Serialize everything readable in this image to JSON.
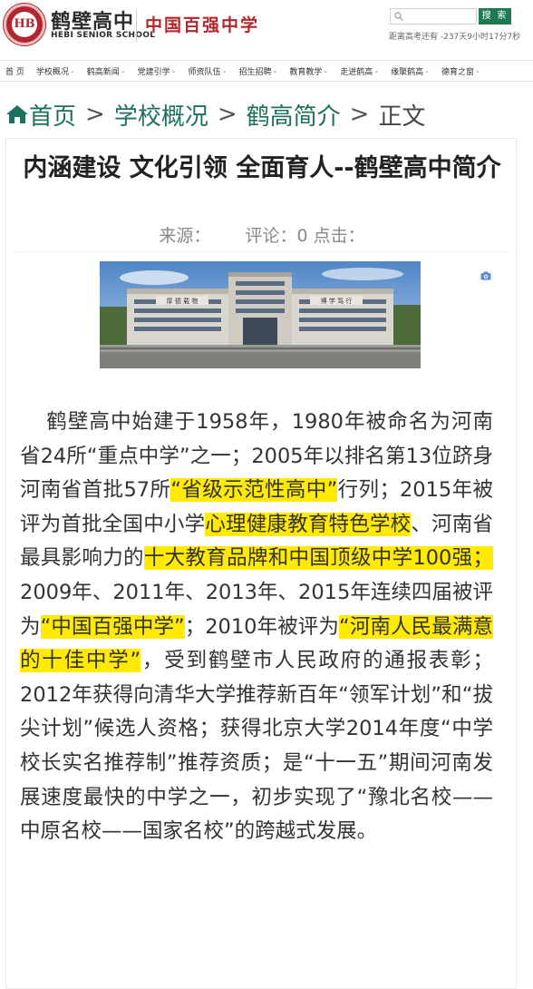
{
  "header": {
    "logo_text": "HB",
    "school_name": "鹤壁高中",
    "school_name_en": "HEBI SENIOR SCHOOL",
    "slogan": "中国百强中学",
    "search_placeholder": "",
    "search_button": "搜 索",
    "countdown": "距离高考还有 -237天9小时17分7秒"
  },
  "nav": {
    "items": [
      {
        "label": "首 页",
        "has_menu": false
      },
      {
        "label": "学校概况",
        "has_menu": true
      },
      {
        "label": "鹤高新闻",
        "has_menu": true
      },
      {
        "label": "党建引学",
        "has_menu": true
      },
      {
        "label": "师资队伍",
        "has_menu": true
      },
      {
        "label": "招生招聘",
        "has_menu": true
      },
      {
        "label": "教育教学",
        "has_menu": true
      },
      {
        "label": "走进鹤高",
        "has_menu": true
      },
      {
        "label": "缘聚鹤高",
        "has_menu": true
      },
      {
        "label": "德育之窗",
        "has_menu": true
      }
    ]
  },
  "breadcrumb": {
    "home": "首页",
    "level1": "学校概况",
    "level2": "鹤高简介",
    "current": "正文",
    "separator": ">"
  },
  "article": {
    "title": "内涵建设 文化引领 全面育人--鹤壁高中简介",
    "source_label": "来源：",
    "comment_label": "评论：",
    "comment_count": "0",
    "click_label": "点击：",
    "photo_caption_left": "厚 德 载 物",
    "photo_caption_right": "博 学 笃 行",
    "body": {
      "s1": "鹤壁高中始建于1958年，1980年被命名为河南省24所“重点中学”之一；2005年以排名第13位跻身河南省首批57所",
      "h1": "“省级示范性高中”",
      "s2": "行列；2015年被评为首批全国中小学",
      "h2": "心理健康教育特色学校",
      "s3": "、河南省最具影响力的",
      "h3": "十大教育品牌和中国顶级中学100强；",
      "s4": "2009年、2011年、2013年、2015年连续四届被评为",
      "h4": "“中国百强中学”",
      "s5": "；2010年被评为",
      "h5": "“河南人民最满意的十佳中学”",
      "s6": "，受到鹤壁市人民政府的通报表彰；2012年获得向清华大学推荐新百年“领军计划”和“拔尖计划”候选人资格；获得北京大学2014年度“中学校长实名推荐制”推荐资质；是“十一五”期间河南发展速度最快的中学之一，初步实现了“豫北名校——中原名校——国家名校”的跨越式发展。"
    }
  },
  "colors": {
    "brand_red": "#b3262d",
    "brand_green": "#1e7a53",
    "link_green": "#1e6f5c",
    "highlight": "#ffea00"
  },
  "icons": {
    "logo": "school-seal-icon",
    "search": "search-icon",
    "home": "home-icon",
    "camera": "camera-icon",
    "menu_chevron": "chevron-down-icon"
  }
}
